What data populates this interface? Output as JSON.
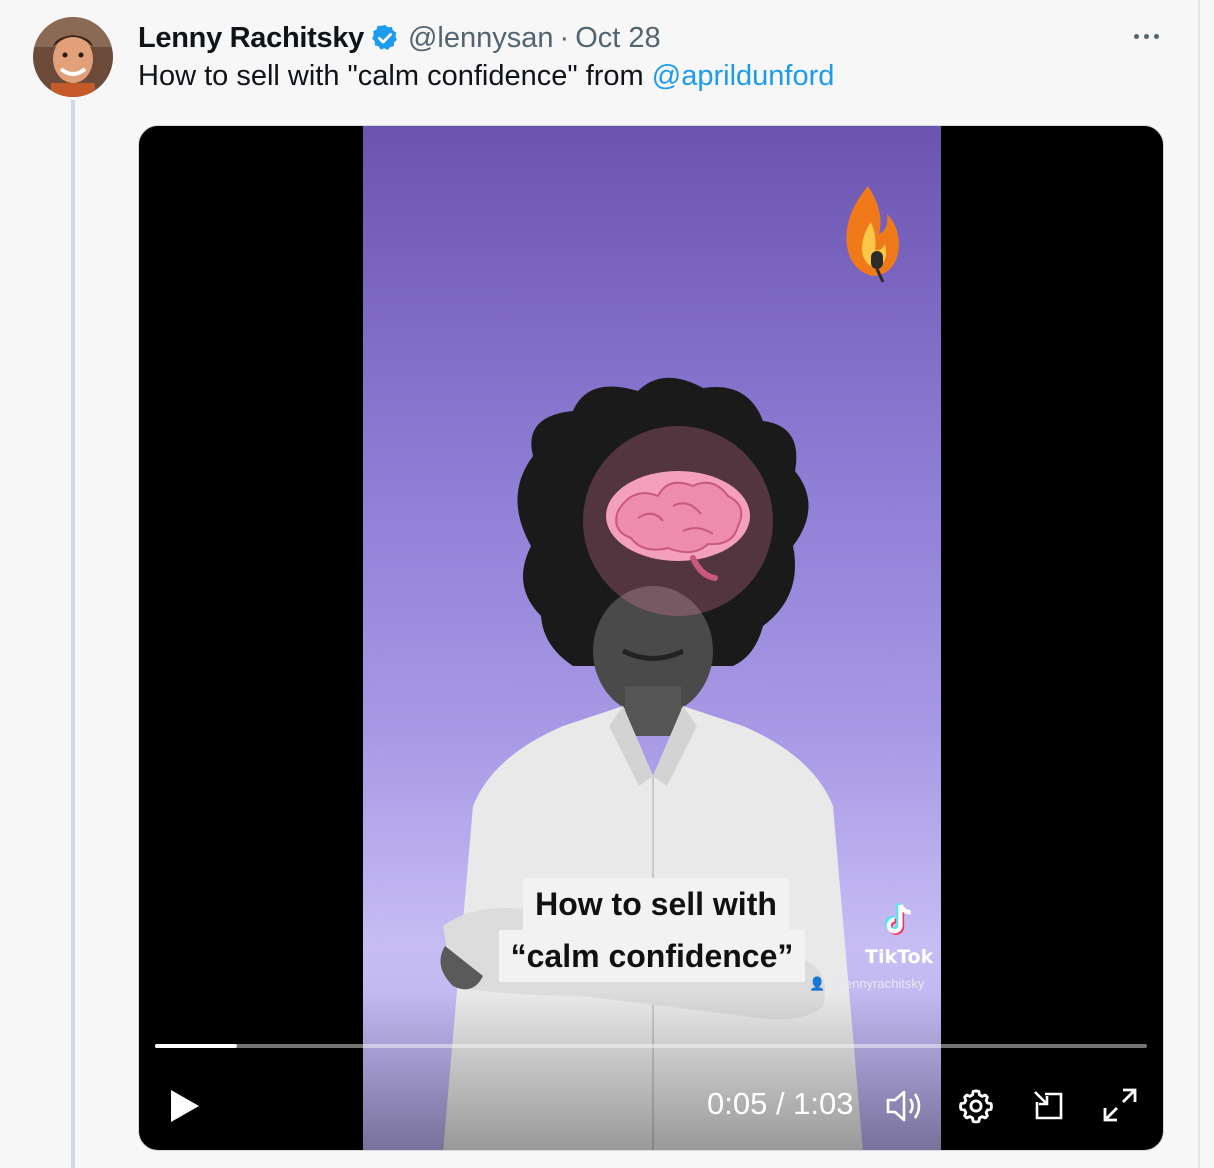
{
  "tweet": {
    "author_name": "Lenny Rachitsky",
    "handle": "@lennysan",
    "separator": "·",
    "date": "Oct 28",
    "text_prefix": "How to sell with \"calm confidence\" from ",
    "mention": "@aprildunford"
  },
  "video": {
    "caption_line1": "How to sell with",
    "caption_line2": "“calm confidence”",
    "watermark_brand": "TikTok",
    "watermark_handle": "@lennyrachitsky",
    "time_display": "0:05 / 1:03",
    "progress_fraction": 0.083
  },
  "icons": {
    "verified": "verified-badge-icon",
    "more": "more-options-icon",
    "play": "play-icon",
    "volume": "volume-icon",
    "settings": "gear-icon",
    "popout": "pop-out-icon",
    "fullscreen": "fullscreen-icon"
  },
  "colors": {
    "link": "#1d9bf0",
    "verified": "#1d9bf0",
    "background_purple": "#8f7ed6"
  }
}
